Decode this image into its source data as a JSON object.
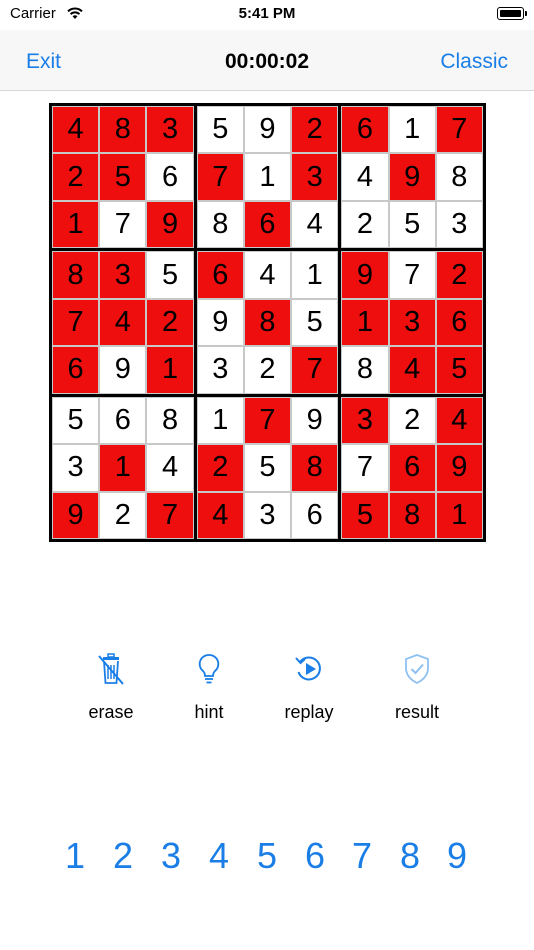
{
  "status": {
    "carrier": "Carrier",
    "time": "5:41 PM"
  },
  "nav": {
    "left": "Exit",
    "title": "00:00:02",
    "right": "Classic"
  },
  "colors": {
    "accent": "#1a7ee6",
    "red_cell": "#ee0e0e",
    "white_cell": "#ffffff"
  },
  "board": {
    "rows": [
      [
        "4",
        "8",
        "3",
        "5",
        "9",
        "2",
        "6",
        "1",
        "7"
      ],
      [
        "2",
        "5",
        "6",
        "7",
        "1",
        "3",
        "4",
        "9",
        "8"
      ],
      [
        "1",
        "7",
        "9",
        "8",
        "6",
        "4",
        "2",
        "5",
        "3"
      ],
      [
        "8",
        "3",
        "5",
        "6",
        "4",
        "1",
        "9",
        "7",
        "2"
      ],
      [
        "7",
        "4",
        "2",
        "9",
        "8",
        "5",
        "1",
        "3",
        "6"
      ],
      [
        "6",
        "9",
        "1",
        "3",
        "2",
        "7",
        "8",
        "4",
        "5"
      ],
      [
        "5",
        "6",
        "8",
        "1",
        "7",
        "9",
        "3",
        "2",
        "4"
      ],
      [
        "3",
        "1",
        "4",
        "2",
        "5",
        "8",
        "7",
        "6",
        "9"
      ],
      [
        "9",
        "2",
        "7",
        "4",
        "3",
        "6",
        "5",
        "8",
        "1"
      ]
    ],
    "red": [
      [
        1,
        1,
        1,
        0,
        0,
        1,
        1,
        0,
        1
      ],
      [
        1,
        1,
        0,
        1,
        0,
        1,
        0,
        1,
        0
      ],
      [
        1,
        0,
        1,
        0,
        1,
        0,
        0,
        0,
        0
      ],
      [
        1,
        1,
        0,
        1,
        0,
        0,
        1,
        0,
        1
      ],
      [
        1,
        1,
        1,
        0,
        1,
        0,
        1,
        1,
        1
      ],
      [
        1,
        0,
        1,
        0,
        0,
        1,
        0,
        1,
        1
      ],
      [
        0,
        0,
        0,
        0,
        1,
        0,
        1,
        0,
        1
      ],
      [
        0,
        1,
        0,
        1,
        0,
        1,
        0,
        1,
        1
      ],
      [
        1,
        0,
        1,
        1,
        0,
        0,
        1,
        1,
        1
      ]
    ]
  },
  "tools": [
    {
      "label": "erase",
      "icon": "trash-icon"
    },
    {
      "label": "hint",
      "icon": "lightbulb-icon"
    },
    {
      "label": "replay",
      "icon": "replay-icon"
    },
    {
      "label": "result",
      "icon": "shield-check-icon"
    }
  ],
  "numpad": [
    "1",
    "2",
    "3",
    "4",
    "5",
    "6",
    "7",
    "8",
    "9"
  ]
}
